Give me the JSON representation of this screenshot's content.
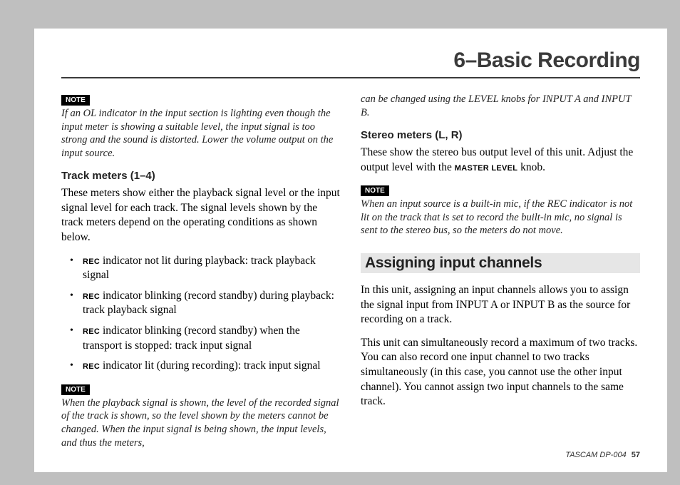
{
  "chapter": "6–Basic Recording",
  "left": {
    "note1": {
      "badge": "NOTE",
      "text": "If an OL indicator in the input section is lighting even though the input meter is showing a suitable level, the input signal is too strong and the sound is distorted. Lower the volume output on the input source."
    },
    "subhead1": "Track meters (1–4)",
    "para1": "These meters show either the playback signal level or the input signal level for each track. The signal levels shown by the track meters depend on the operating conditions as shown below.",
    "rec": "REC",
    "bullets": [
      " indicator not lit during playback: track playback signal",
      " indicator blinking (record standby) during playback: track playback signal",
      " indicator blinking (record standby) when the transport is stopped: track input signal",
      " indicator lit (during recording): track input signal"
    ],
    "note2": {
      "badge": "NOTE",
      "text": "When the playback signal is shown, the level of the recorded signal of the track is shown, so the level shown by the meters cannot be changed. When the input signal is being shown, the input levels, and thus the meters,"
    }
  },
  "right": {
    "cont": "can be changed using the LEVEL knobs for INPUT A and INPUT B.",
    "subhead2": "Stereo meters (L, R)",
    "para2a": "These show the stereo bus output level of this unit. Adjust the output level with the ",
    "master": "MASTER LEVEL",
    "para2b": " knob.",
    "note3": {
      "badge": "NOTE",
      "text": "When an input source is a built-in mic, if the REC indicator is not lit on the track that is set to record the built-in mic, no signal is sent to the stereo bus, so the meters do not move."
    },
    "section": "Assigning input channels",
    "para3": "In this unit, assigning an input channels allows you to assign the signal input from INPUT A or INPUT B as the source for recording on a track.",
    "para4": "This unit can simultaneously record a maximum of two tracks. You can also record one input channel to two tracks simultaneously (in this case, you cannot use the other input channel). You cannot assign two input channels to the same track."
  },
  "footer": {
    "brand": "TASCAM  DP-004",
    "page": "57"
  }
}
